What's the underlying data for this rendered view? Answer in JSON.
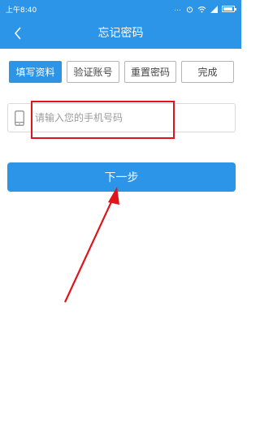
{
  "status_bar": {
    "time": "上午8:40",
    "indicators": "…"
  },
  "nav": {
    "back_icon": "chevron-left-icon",
    "title": "忘记密码"
  },
  "steps": [
    {
      "label": "填写资料",
      "active": true
    },
    {
      "label": "验证账号",
      "active": false
    },
    {
      "label": "重置密码",
      "active": false
    },
    {
      "label": "完成",
      "active": false
    }
  ],
  "phone": {
    "icon": "phone-icon",
    "placeholder": "请输入您的手机号码",
    "value": ""
  },
  "next_button": {
    "label": "下一步"
  },
  "colors": {
    "primary": "#2c95e8",
    "annotation": "#e0151b"
  }
}
